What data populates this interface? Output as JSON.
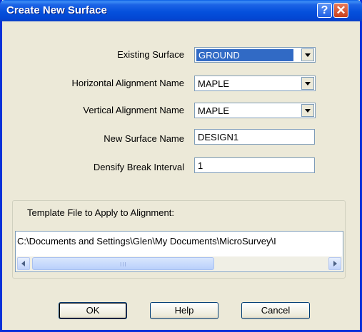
{
  "window": {
    "title": "Create New Surface"
  },
  "fields": {
    "existing_surface": {
      "label": "Existing Surface",
      "value": "GROUND"
    },
    "horizontal_alignment": {
      "label": "Horizontal Alignment Name",
      "value": "MAPLE"
    },
    "vertical_alignment": {
      "label": "Vertical Alignment Name",
      "value": "MAPLE"
    },
    "new_surface_name": {
      "label": "New Surface Name",
      "value": "DESIGN1"
    },
    "densify_break_interval": {
      "label": "Densify Break Interval",
      "value": "1"
    }
  },
  "template_group": {
    "label": "Template File to Apply to Alignment:",
    "path": "C:\\Documents and Settings\\Glen\\My Documents\\MicroSurvey\\I"
  },
  "buttons": {
    "ok": "OK",
    "help": "Help",
    "cancel": "Cancel"
  }
}
